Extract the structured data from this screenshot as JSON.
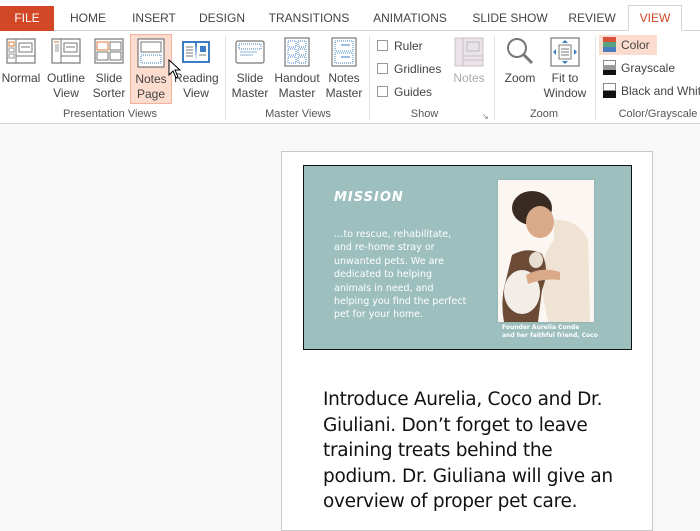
{
  "tabs": [
    {
      "label": "FILE"
    },
    {
      "label": "HOME"
    },
    {
      "label": "INSERT"
    },
    {
      "label": "DESIGN"
    },
    {
      "label": "TRANSITIONS"
    },
    {
      "label": "ANIMATIONS"
    },
    {
      "label": "SLIDE SHOW"
    },
    {
      "label": "REVIEW"
    },
    {
      "label": "VIEW"
    }
  ],
  "active_tab": "VIEW",
  "ribbon": {
    "presentation_views": {
      "label": "Presentation Views",
      "buttons": [
        {
          "line1": "Normal",
          "line2": "",
          "icon": "normal-view-icon"
        },
        {
          "line1": "Outline",
          "line2": "View",
          "icon": "outline-view-icon"
        },
        {
          "line1": "Slide",
          "line2": "Sorter",
          "icon": "slide-sorter-icon"
        },
        {
          "line1": "Notes",
          "line2": "Page",
          "icon": "notes-page-icon",
          "selected": true
        },
        {
          "line1": "Reading",
          "line2": "View",
          "icon": "reading-view-icon"
        }
      ]
    },
    "master_views": {
      "label": "Master Views",
      "buttons": [
        {
          "line1": "Slide",
          "line2": "Master",
          "icon": "slide-master-icon"
        },
        {
          "line1": "Handout",
          "line2": "Master",
          "icon": "handout-master-icon"
        },
        {
          "line1": "Notes",
          "line2": "Master",
          "icon": "notes-master-icon"
        }
      ]
    },
    "show": {
      "label": "Show",
      "checkboxes": [
        {
          "label": "Ruler",
          "checked": false
        },
        {
          "label": "Gridlines",
          "checked": false
        },
        {
          "label": "Guides",
          "checked": false
        }
      ],
      "notes_button": {
        "label": "Notes",
        "disabled": true
      }
    },
    "zoom": {
      "label": "Zoom",
      "buttons": [
        {
          "line1": "Zoom",
          "line2": "",
          "icon": "zoom-icon"
        },
        {
          "line1": "Fit to",
          "line2": "Window",
          "icon": "fit-to-window-icon"
        }
      ]
    },
    "color_grayscale": {
      "label": "Color/Grayscale",
      "options": [
        {
          "label": "Color",
          "selected": true
        },
        {
          "label": "Grayscale",
          "selected": false
        },
        {
          "label": "Black and White",
          "selected": false
        }
      ]
    }
  },
  "slide": {
    "title": "MISSION",
    "body": "…to rescue, rehabilitate, and re-home stray or unwanted pets. We are dedicated to helping animals in need, and helping you find the perfect pet for your home.",
    "caption_line1": "Founder Aurelia Conde",
    "caption_line2": "and her faithful friend, Coco",
    "background_color": "#9dbfbe"
  },
  "notes": {
    "text": "Introduce Aurelia, Coco and Dr. Giuliani. Don’t forget to leave training treats behind the podium. Dr. Giuliana will give an overview of proper pet care."
  },
  "colors": {
    "accent": "#d24726",
    "selected_bg": "#fcdccf"
  }
}
